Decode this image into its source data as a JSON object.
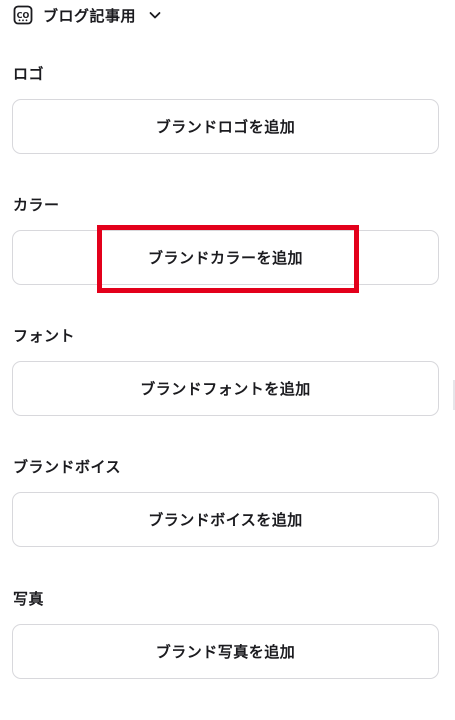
{
  "header": {
    "title": "ブログ記事用",
    "icon": "brand-kit-icon",
    "chevron": "chevron-down-icon"
  },
  "sections": [
    {
      "label": "ロゴ",
      "button": "ブランドロゴを追加"
    },
    {
      "label": "カラー",
      "button": "ブランドカラーを追加"
    },
    {
      "label": "フォント",
      "button": "ブランドフォントを追加"
    },
    {
      "label": "ブランドボイス",
      "button": "ブランドボイスを追加"
    },
    {
      "label": "写真",
      "button": "ブランド写真を追加"
    }
  ],
  "colors": {
    "highlight": "#e3001b",
    "border": "#d8d8dc",
    "text": "#1b1b1f"
  }
}
